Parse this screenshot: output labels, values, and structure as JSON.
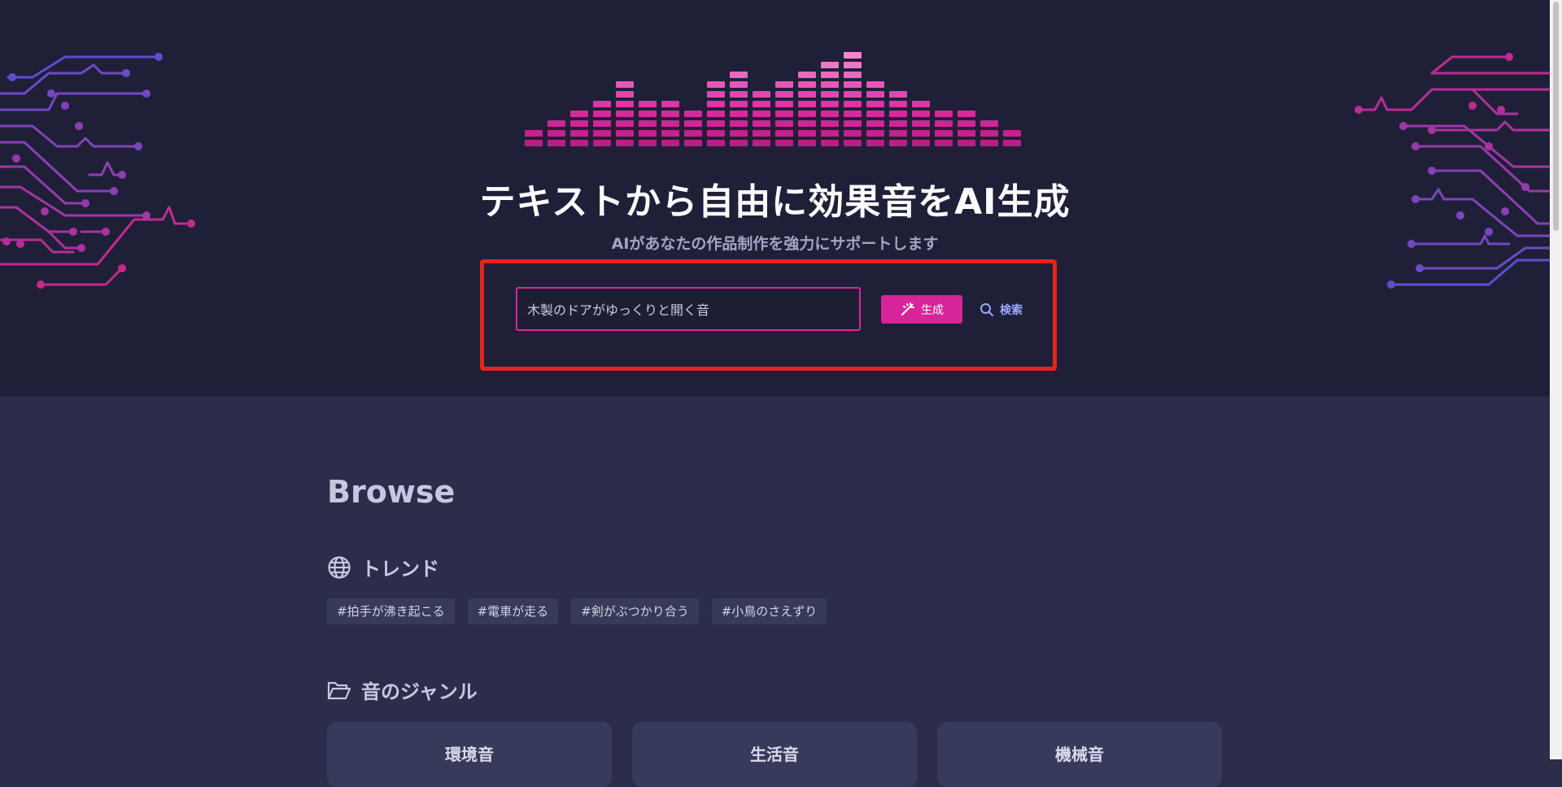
{
  "hero": {
    "title": "テキストから自由に効果音をAI生成",
    "subtitle": "AIがあなたの作品制作を強力にサポートします"
  },
  "search": {
    "value": "木製のドアがゆっくりと開く音",
    "generate_label": "生成",
    "search_label": "検索"
  },
  "browse": {
    "title": "Browse",
    "trend_label": "トレンド",
    "trend_tags": [
      "#拍手が沸き起こる",
      "#電車が走る",
      "#剣がぶつかり合う",
      "#小鳥のさえずり"
    ],
    "genre_label": "音のジャンル",
    "genres": [
      "環境音",
      "生活音",
      "機械音"
    ]
  },
  "colors": {
    "accent": "#d6259b",
    "hero_bg": "#1f2038",
    "page_bg": "#2b2d4a",
    "link": "#9da7ff",
    "highlight": "#e5241e"
  },
  "icons": {
    "generate": "magic-wand-icon",
    "search": "search-icon",
    "trend": "globe-icon",
    "genre": "folder-open-icon"
  }
}
